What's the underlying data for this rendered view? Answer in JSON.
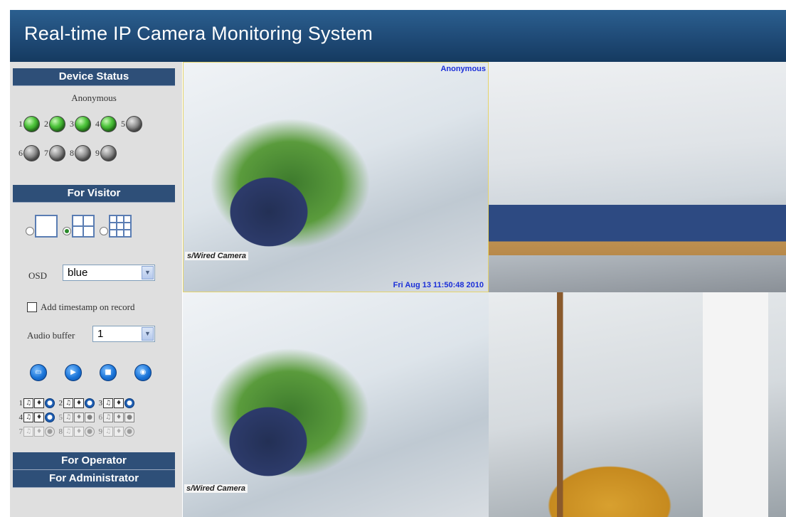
{
  "header": {
    "title": "Real-time IP Camera Monitoring System"
  },
  "sidebar": {
    "device_status": {
      "heading": "Device Status",
      "user": "Anonymous",
      "devices": [
        {
          "n": "1",
          "state": "online"
        },
        {
          "n": "2",
          "state": "online"
        },
        {
          "n": "3",
          "state": "online"
        },
        {
          "n": "4",
          "state": "online"
        },
        {
          "n": "5",
          "state": "offline"
        },
        {
          "n": "6",
          "state": "offline"
        },
        {
          "n": "7",
          "state": "offline"
        },
        {
          "n": "8",
          "state": "offline"
        },
        {
          "n": "9",
          "state": "offline"
        }
      ]
    },
    "visitor": {
      "heading": "For Visitor",
      "layouts": [
        {
          "name": "1-view",
          "selected": false
        },
        {
          "name": "4-view",
          "selected": true
        },
        {
          "name": "9-view",
          "selected": false
        }
      ],
      "osd_label": "OSD",
      "osd_value": "blue",
      "timestamp_label": "Add timestamp on record",
      "timestamp_checked": false,
      "audio_buffer_label": "Audio buffer",
      "audio_buffer_value": "1",
      "controls": [
        "folder-icon",
        "play-icon",
        "stop-icon",
        "snapshot-icon"
      ],
      "record_numbers": [
        "1",
        "2",
        "3",
        "4",
        "5",
        "6",
        "7",
        "8",
        "9"
      ]
    },
    "operator": {
      "heading": "For Operator"
    },
    "administrator": {
      "heading": "For Administrator"
    }
  },
  "videos": {
    "v1": {
      "osd_name": "Anonymous",
      "osd_time": "Fri Aug 13 11:50:48 2010",
      "overlay": "s/Wired Camera"
    },
    "v3": {
      "overlay": "s/Wired Camera"
    }
  },
  "colors": {
    "header": "#1f4a76",
    "section": "#2e4f78",
    "sidebar": "#dfdfdf",
    "osd": "#1b2fd8"
  }
}
